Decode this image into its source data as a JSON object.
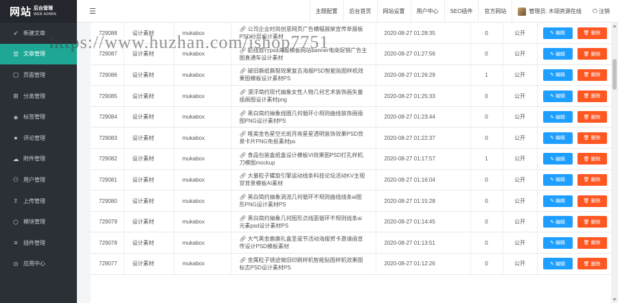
{
  "sidebar": {
    "logo_main": "网站",
    "logo_sub1": "后台管理",
    "logo_sub2": "WEB ADMIN",
    "items": [
      {
        "label": "新建文章",
        "icon": "send-icon",
        "active": false
      },
      {
        "label": "文章管理",
        "icon": "list-icon",
        "active": true
      },
      {
        "label": "页面管理",
        "icon": "page-icon",
        "active": false
      },
      {
        "label": "分类管理",
        "icon": "category-icon",
        "active": false
      },
      {
        "label": "标签管理",
        "icon": "tag-icon",
        "active": false
      },
      {
        "label": "评论管理",
        "icon": "comment-icon",
        "active": false
      },
      {
        "label": "附件管理",
        "icon": "cloud-icon",
        "active": false
      },
      {
        "label": "用户管理",
        "icon": "user-icon",
        "active": false
      },
      {
        "label": "上传管理",
        "icon": "upload-icon",
        "active": false
      },
      {
        "label": "模块管理",
        "icon": "module-icon",
        "active": false
      },
      {
        "label": "插件管理",
        "icon": "plugin-icon",
        "active": false
      },
      {
        "label": "应用中心",
        "icon": "app-center-icon",
        "active": false
      }
    ]
  },
  "header": {
    "nav": [
      "主题配置",
      "后台首页",
      "网站设置",
      "用户中心",
      "SEO插件",
      "官方网站"
    ],
    "user_label": "管理员: 木翊资源在线",
    "logout": "注销"
  },
  "table": {
    "edit_label": "编辑",
    "delete_label": "删除",
    "rows": [
      {
        "id": "729088",
        "category": "设计素材",
        "author": "mukabox",
        "title": "公司企业时尚创意网页广告横幅展架宣传单展板PSD分层设计素材",
        "date": "2020-08-27 01:28:35",
        "views": "0",
        "status": "公开"
      },
      {
        "id": "729087",
        "category": "设计素材",
        "author": "mukabox",
        "title": "航线旅行psd海报模板网站banner电商促销广告主图直通车设计素材",
        "date": "2020-08-27 01:27:56",
        "views": "0",
        "status": "公开"
      },
      {
        "id": "729086",
        "category": "设计素材",
        "author": "mukabox",
        "title": "破旧撕纸撕裂效果复古海报PSD智能贴图样机效果图模板设计素材PS",
        "date": "2020-08-27 01:26:29",
        "views": "1",
        "status": "公开"
      },
      {
        "id": "729085",
        "category": "设计素材",
        "author": "mukabox",
        "title": "漂浮简约现代抽象女性人物几何艺术装饰画矢量插画图设计素材png",
        "date": "2020-08-27 01:25:33",
        "views": "0",
        "status": "公开"
      },
      {
        "id": "729084",
        "category": "设计素材",
        "author": "mukabox",
        "title": "黑白简约抽象线圈几何循环小规则曲线装饰画插图PNG设计素材PS",
        "date": "2020-08-27 01:23:44",
        "views": "0",
        "status": "公开"
      },
      {
        "id": "729083",
        "category": "设计素材",
        "author": "mukabox",
        "title": "唯美金色星空光斑月亮星星透明装饰效果PSD背景卡片PNG免抠素材ps",
        "date": "2020-08-27 01:22:37",
        "views": "0",
        "status": "公开"
      },
      {
        "id": "729082",
        "category": "设计素材",
        "author": "mukabox",
        "title": "食品包装盒纸盒设计模板VI效果图PSD打孔样机刀模图mockup",
        "date": "2020-08-27 01:17:57",
        "views": "1",
        "status": "公开"
      },
      {
        "id": "729081",
        "category": "设计素材",
        "author": "mukabox",
        "title": "大量粒子螺旋引擎运动线条科技论坛活动KV主视觉背景模板AI素材",
        "date": "2020-08-27 01:16:04",
        "views": "0",
        "status": "公开"
      },
      {
        "id": "729080",
        "category": "设计素材",
        "author": "mukabox",
        "title": "黑白简约抽象涡流几何循环不规则曲线线条ai图形PNG设计素材PS",
        "date": "2020-08-27 01:15:28",
        "views": "0",
        "status": "公开"
      },
      {
        "id": "729079",
        "category": "设计素材",
        "author": "mukabox",
        "title": "黑白简约抽象几何图形点线面循环不规则线条ai元素psd设计素材PS",
        "date": "2020-08-27 01:14:45",
        "views": "0",
        "status": "公开"
      },
      {
        "id": "729078",
        "category": "设计素材",
        "author": "mukabox",
        "title": "大气黑金鹿鹿礼盒圣诞节活动海报贺卡邀请函宣传设计PSD模板素材",
        "date": "2020-08-27 01:13:51",
        "views": "0",
        "status": "公开"
      },
      {
        "id": "729077",
        "category": "设计素材",
        "author": "mukabox",
        "title": "金属粒子锈迹做旧印刷样机智能贴图样机效果图标志PSD设计素材PS",
        "date": "2020-08-27 01:12:26",
        "views": "0",
        "status": "公开"
      }
    ]
  },
  "watermark": "https://www.huzhan.com/ishop7751"
}
